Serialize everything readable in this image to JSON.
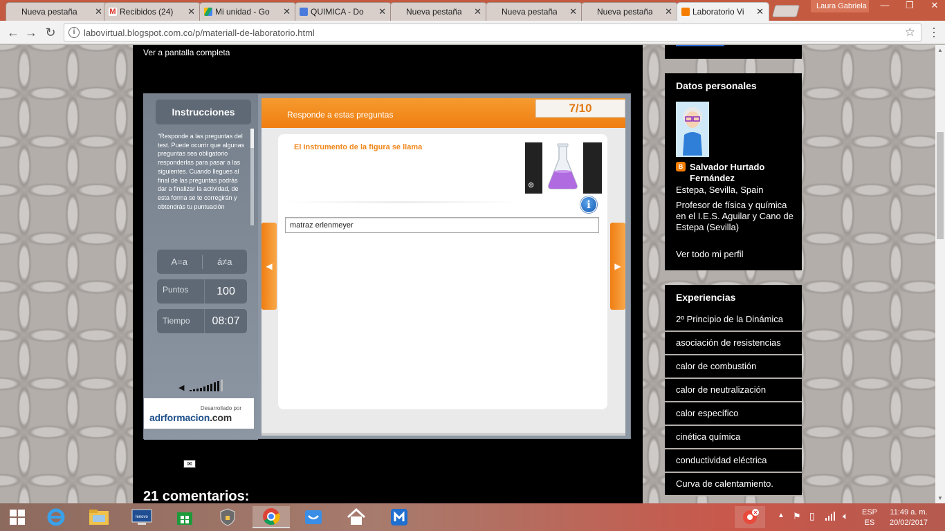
{
  "browser": {
    "tabs": [
      {
        "label": "Nueva pestaña",
        "favicon_color": "#dcdcdc",
        "left": 0
      },
      {
        "label": "Recibidos (24)",
        "favicon_color": "#d93025"
      },
      {
        "label": "Mi unidad - Go",
        "favicon_color": "#1fa463"
      },
      {
        "label": "QUIMICA - Do",
        "favicon_color": "#4a7bdc"
      },
      {
        "label": "Nueva pestaña",
        "favicon_color": "#dcdcdc"
      },
      {
        "label": "Nueva pestaña",
        "favicon_color": "#dcdcdc"
      },
      {
        "label": "Nueva pestaña",
        "favicon_color": "#dcdcdc"
      },
      {
        "label": "Laboratorio Vi",
        "favicon_color": "#f57d00",
        "active": true
      }
    ],
    "user": "Laura Gabriela",
    "url": "labovirtual.blogspot.com.co/p/materiall-de-laboratorio.html",
    "icons": {
      "back": "arrow-left-icon",
      "forward": "arrow-right-icon",
      "reload": "reload-icon",
      "bookmark": "star-icon",
      "menu": "kebab-menu-icon"
    }
  },
  "page": {
    "fullscreen_link": "Ver a pantalla completa",
    "quiz": {
      "instructions_title": "Instrucciones",
      "instructions_text": "\"Responde a las preguntas del test. Puede ocurrir que algunas preguntas sea obligatorio responderlas para pasar a las siguientes. Cuando llegues al final de las preguntas podrás dar a finalizar la actividad, de esta forma se te corregirán y obtendrás tu puntuación",
      "case_toggle": {
        "left": "A=a",
        "right": "á≠a"
      },
      "points_label": "Puntos",
      "points_value": "100",
      "time_label": "Tiempo",
      "time_value": "08:07",
      "logo_small": "Desarrollado por",
      "logo_main": "adrformacion",
      "logo_tld": ".com",
      "header_text": "Responde a estas preguntas",
      "counter": "7/10",
      "question": "El instrumento de la figura se llama",
      "answer_value": "matraz erlenmeyer",
      "nav_prev": "◀",
      "nav_next": "▶"
    },
    "comments_title": "21 comentarios:"
  },
  "sidebar": {
    "profile_title": "Datos personales",
    "profile_name_1": "Salvador Hurtado",
    "profile_name_2": "Fernández",
    "profile_location": "Estepa, Sevilla, Spain",
    "profile_description": "Profesor de física y química en el I.E.S. Aguilar y Cano de Estepa (Sevilla)",
    "profile_link": "Ver todo mi perfil",
    "experiences_title": "Experiencias",
    "experiences": [
      "2º Principio de la Dinámica",
      "asociación de resistencias",
      "calor de combustión",
      "calor de neutralización",
      "calor específico",
      "cinética química",
      "conductividad eléctrica",
      "Curva de calentamiento."
    ]
  },
  "taskbar": {
    "lang_1": "ESP",
    "lang_2": "ES",
    "time": "11:49 a. m.",
    "date": "20/02/2017"
  }
}
